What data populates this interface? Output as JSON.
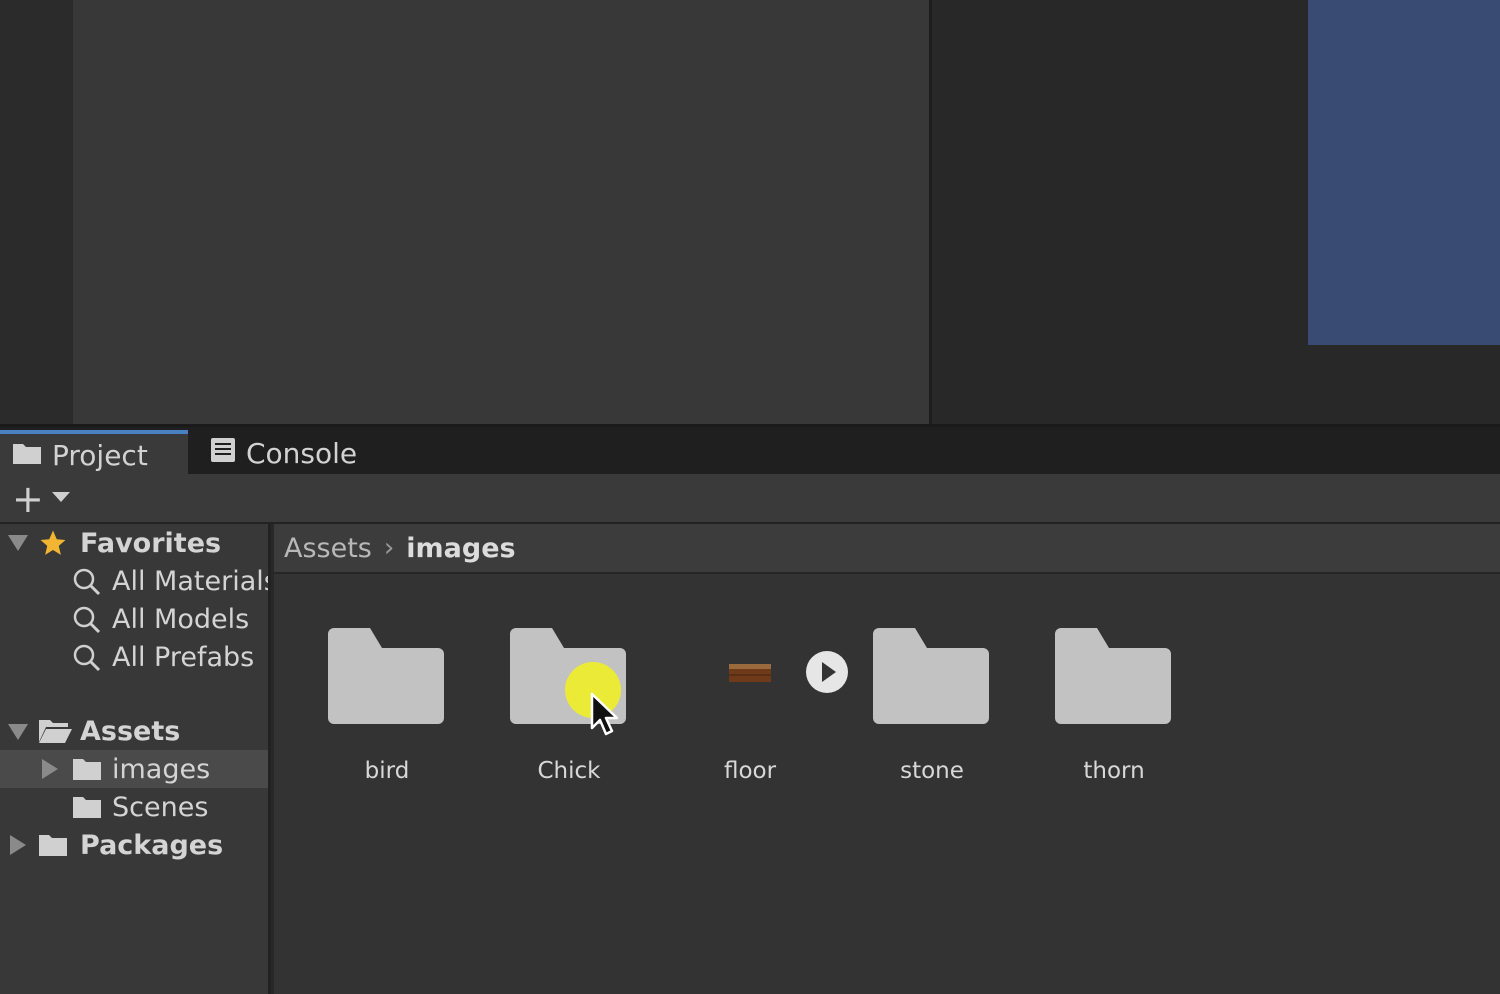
{
  "tabs": [
    {
      "label": "Project",
      "icon": "folder-icon",
      "active": true
    },
    {
      "label": "Console",
      "icon": "console-icon",
      "active": false
    }
  ],
  "toolbar": {
    "add_icon": "plus-icon",
    "dropdown_icon": "caret-down-icon"
  },
  "tree": {
    "favorites": {
      "label": "Favorites",
      "items": [
        "All Materials",
        "All Models",
        "All Prefabs"
      ]
    },
    "assets": {
      "label": "Assets",
      "items": [
        "images",
        "Scenes"
      ]
    },
    "packages": {
      "label": "Packages"
    }
  },
  "breadcrumb": {
    "root": "Assets",
    "current": "images"
  },
  "assets": [
    {
      "label": "bird",
      "type": "folder"
    },
    {
      "label": "Chick",
      "type": "folder"
    },
    {
      "label": "floor",
      "type": "sprite"
    },
    {
      "label": "stone",
      "type": "folder"
    },
    {
      "label": "thorn",
      "type": "folder"
    }
  ],
  "colors": {
    "accent": "#4a7fc0",
    "scene_blue": "#394b73",
    "highlight": "#f0f028"
  }
}
